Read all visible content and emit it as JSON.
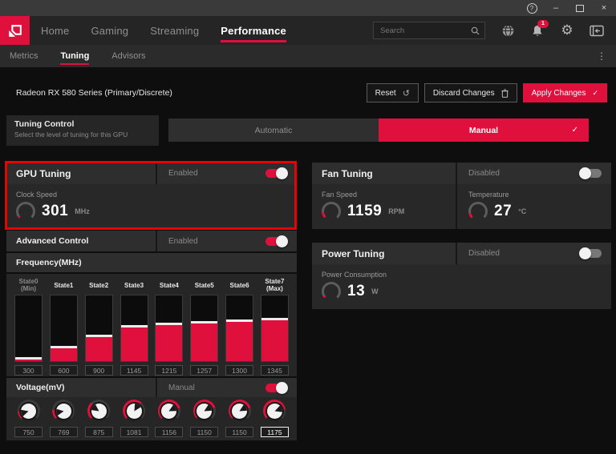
{
  "colors": {
    "accent": "#e0103c",
    "annotation": "#e80202"
  },
  "titlebar": {
    "help": "?",
    "minimize": "–",
    "close": "×"
  },
  "navbar": {
    "items": [
      {
        "label": "Home",
        "active": false
      },
      {
        "label": "Gaming",
        "active": false
      },
      {
        "label": "Streaming",
        "active": false
      },
      {
        "label": "Performance",
        "active": true
      }
    ],
    "search": {
      "placeholder": "Search"
    },
    "notification_count": "1"
  },
  "subnav": {
    "tabs": [
      {
        "label": "Metrics",
        "active": false
      },
      {
        "label": "Tuning",
        "active": true
      },
      {
        "label": "Advisors",
        "active": false
      }
    ]
  },
  "toolbar": {
    "device_name": "Radeon RX 580 Series (Primary/Discrete)",
    "reset_label": "Reset",
    "discard_label": "Discard Changes",
    "apply_label": "Apply Changes",
    "apply_check": "✓",
    "reset_icon_glyph": "↺"
  },
  "tuning_control": {
    "title": "Tuning Control",
    "subtitle": "Select the level of tuning for this GPU",
    "options": [
      "Automatic",
      "Manual"
    ],
    "selected": "Manual",
    "check": "✓"
  },
  "gpu_tuning": {
    "title": "GPU Tuning",
    "status": "Enabled",
    "enabled": true,
    "clock_speed": {
      "label": "Clock Speed",
      "value": "301",
      "unit": "MHz",
      "arc": 0.04
    }
  },
  "advanced_control": {
    "title": "Advanced Control",
    "status": "Enabled",
    "enabled": true
  },
  "frequency": {
    "title": "Frequency(MHz)"
  },
  "chart_data": {
    "type": "bar",
    "title": "Frequency(MHz)",
    "categories": [
      "State0 (Min)",
      "State1",
      "State2",
      "State3",
      "State4",
      "State5",
      "State6",
      "State7 (Max)"
    ],
    "values": [
      300,
      600,
      900,
      1145,
      1215,
      1257,
      1300,
      1345
    ],
    "ylim": [
      250,
      2000
    ],
    "ylabel": "MHz",
    "legend_position": "none",
    "grid": false
  },
  "frequency_states": [
    {
      "label": "State0",
      "sublabel": "(Min)",
      "value": "300",
      "muted": true
    },
    {
      "label": "State1",
      "sublabel": "",
      "value": "600",
      "muted": false
    },
    {
      "label": "State2",
      "sublabel": "",
      "value": "900",
      "muted": false
    },
    {
      "label": "State3",
      "sublabel": "",
      "value": "1145",
      "muted": false
    },
    {
      "label": "State4",
      "sublabel": "",
      "value": "1215",
      "muted": false
    },
    {
      "label": "State5",
      "sublabel": "",
      "value": "1257",
      "muted": false
    },
    {
      "label": "State6",
      "sublabel": "",
      "value": "1300",
      "muted": false
    },
    {
      "label": "State7",
      "sublabel": "(Max)",
      "value": "1345",
      "muted": false
    }
  ],
  "voltage": {
    "title": "Voltage(mV)",
    "mode": "Manual",
    "enabled": true,
    "range": [
      650,
      1300
    ],
    "knobs": [
      {
        "value": "750",
        "editing": false
      },
      {
        "value": "769",
        "editing": false
      },
      {
        "value": "875",
        "editing": false
      },
      {
        "value": "1081",
        "editing": false
      },
      {
        "value": "1156",
        "editing": false
      },
      {
        "value": "1150",
        "editing": false
      },
      {
        "value": "1150",
        "editing": false
      },
      {
        "value": "1175",
        "editing": true
      }
    ]
  },
  "fan_tuning": {
    "title": "Fan Tuning",
    "status": "Disabled",
    "enabled": false,
    "fan_speed": {
      "label": "Fan Speed",
      "value": "1159",
      "unit": "RPM",
      "arc": 0.15
    },
    "temperature": {
      "label": "Temperature",
      "value": "27",
      "unit": "°C",
      "arc": 0.12
    }
  },
  "power_tuning": {
    "title": "Power Tuning",
    "status": "Disabled",
    "enabled": false,
    "power_consumption": {
      "label": "Power Consumption",
      "value": "13",
      "unit": "W",
      "arc": 0.05
    }
  }
}
